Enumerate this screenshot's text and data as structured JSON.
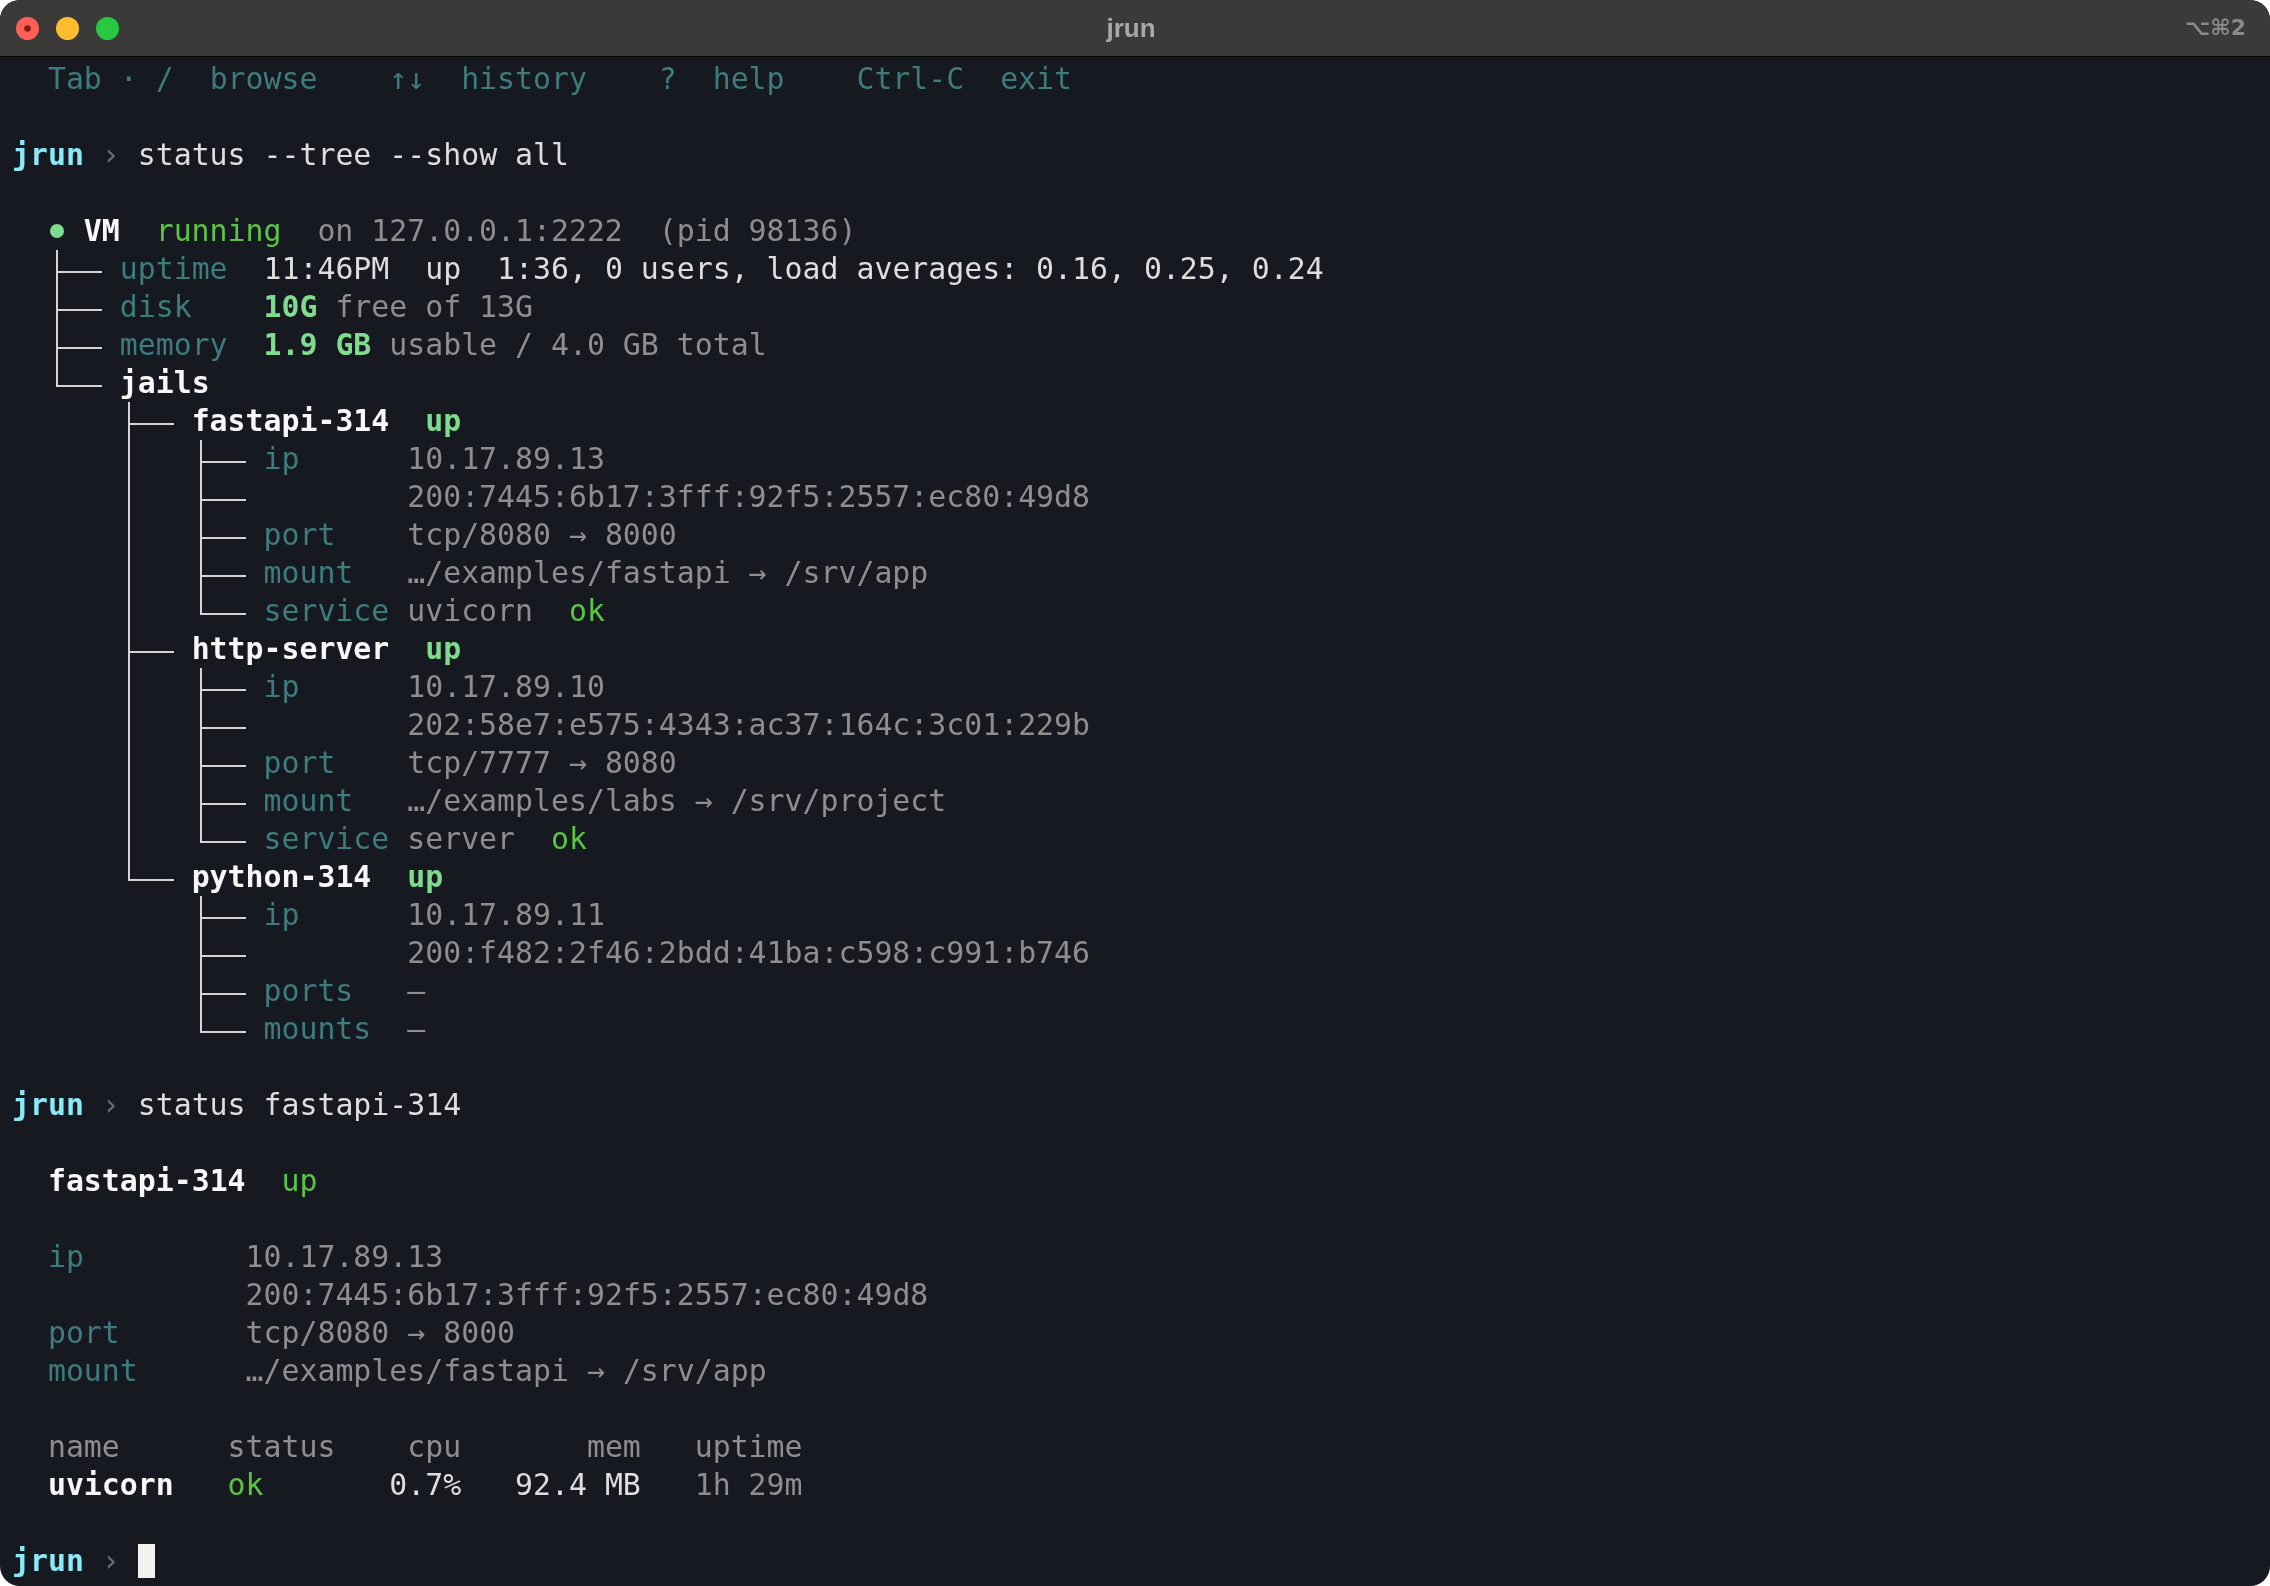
{
  "window": {
    "title": "jrun",
    "shortcut": "⌥⌘2",
    "busy": true
  },
  "hints": [
    {
      "key": "Tab · /",
      "action": "browse"
    },
    {
      "key": "↑↓",
      "action": "history"
    },
    {
      "key": "?",
      "action": "help"
    },
    {
      "key": "Ctrl-C",
      "action": "exit"
    }
  ],
  "session": [
    {
      "kind": "prompt",
      "prompt": "jrun",
      "symbol": "›",
      "command": "status --tree --show all"
    },
    {
      "kind": "tree",
      "root": {
        "name": "VM",
        "online": true,
        "state": "running",
        "address": "on 127.0.0.1:2222",
        "pid": "(pid 98136)",
        "children": [
          {
            "kind": "field",
            "label": "uptime",
            "value": "11:46PM  up  1:36, 0 users, load averages: 0.16, 0.25, 0.24"
          },
          {
            "kind": "usage",
            "label": "disk",
            "amount": "10G",
            "rest": "free of 13G"
          },
          {
            "kind": "usage",
            "label": "memory",
            "amount": "1.9 GB",
            "rest": "usable / 4.0 GB total"
          },
          {
            "kind": "group",
            "label": "jails",
            "children": [
              {
                "name": "fastapi-314",
                "state": "up",
                "children": [
                  {
                    "label": "ip",
                    "value": "10.17.89.13"
                  },
                  {
                    "value": "200:7445:6b17:3fff:92f5:2557:ec80:49d8"
                  },
                  {
                    "label": "port",
                    "value": "tcp/8080 → 8000"
                  },
                  {
                    "label": "mount",
                    "value": "…/examples/fastapi → /srv/app"
                  },
                  {
                    "label": "service",
                    "value": "uvicorn",
                    "status": "ok"
                  }
                ]
              },
              {
                "name": "http-server",
                "state": "up",
                "children": [
                  {
                    "label": "ip",
                    "value": "10.17.89.10"
                  },
                  {
                    "value": "202:58e7:e575:4343:ac37:164c:3c01:229b"
                  },
                  {
                    "label": "port",
                    "value": "tcp/7777 → 8080"
                  },
                  {
                    "label": "mount",
                    "value": "…/examples/labs → /srv/project"
                  },
                  {
                    "label": "service",
                    "value": "server",
                    "status": "ok"
                  }
                ]
              },
              {
                "name": "python-314",
                "state": "up",
                "children": [
                  {
                    "label": "ip",
                    "value": "10.17.89.11"
                  },
                  {
                    "value": "200:f482:2f46:2bdd:41ba:c598:c991:b746"
                  },
                  {
                    "label": "ports",
                    "value": "—"
                  },
                  {
                    "label": "mounts",
                    "value": "—"
                  }
                ]
              }
            ]
          }
        ]
      }
    },
    {
      "kind": "prompt",
      "prompt": "jrun",
      "symbol": "›",
      "command": "status fastapi-314"
    },
    {
      "kind": "detail",
      "name": "fastapi-314",
      "state": "up",
      "fields": [
        {
          "label": "ip",
          "value": "10.17.89.13"
        },
        {
          "value": "200:7445:6b17:3fff:92f5:2557:ec80:49d8"
        },
        {
          "label": "port",
          "value": "tcp/8080 → 8000"
        },
        {
          "label": "mount",
          "value": "…/examples/fastapi → /srv/app"
        }
      ],
      "table": {
        "columns": [
          "name",
          "status",
          "cpu",
          "mem",
          "uptime"
        ],
        "rows": [
          [
            "uvicorn",
            "ok",
            "0.7%",
            "92.4 MB",
            "1h 29m"
          ]
        ]
      }
    },
    {
      "kind": "prompt",
      "prompt": "jrun",
      "symbol": "›",
      "cursor": true
    }
  ]
}
